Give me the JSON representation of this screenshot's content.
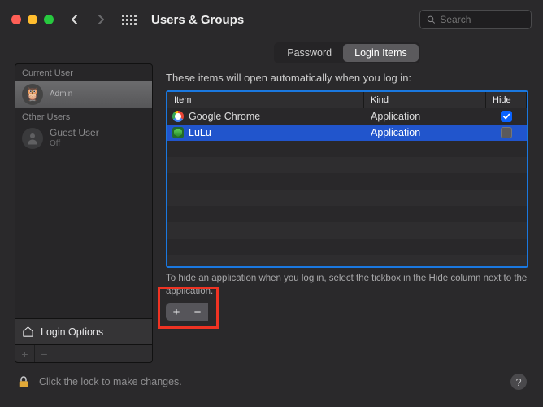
{
  "window": {
    "title": "Users & Groups"
  },
  "search": {
    "placeholder": "Search"
  },
  "sidebar": {
    "current_hdr": "Current User",
    "other_hdr": "Other Users",
    "current": {
      "name": "",
      "role": "Admin"
    },
    "guest": {
      "name": "Guest User",
      "status": "Off"
    },
    "login_options_label": "Login Options",
    "plus": "+",
    "minus": "−"
  },
  "tabs": {
    "password": "Password",
    "login_items": "Login Items"
  },
  "main": {
    "intro": "These items will open automatically when you log in:",
    "columns": {
      "item": "Item",
      "kind": "Kind",
      "hide": "Hide"
    },
    "rows": [
      {
        "name": "Google Chrome",
        "kind": "Application",
        "hide": true,
        "selected": false,
        "icon": "chrome"
      },
      {
        "name": "LuLu",
        "kind": "Application",
        "hide": false,
        "selected": true,
        "icon": "lulu"
      }
    ],
    "hint": "To hide an application when you log in, select the tickbox in the Hide column next to the application.",
    "plus": "+",
    "minus": "−"
  },
  "footer": {
    "lock_text": "Click the lock to make changes.",
    "help": "?"
  }
}
